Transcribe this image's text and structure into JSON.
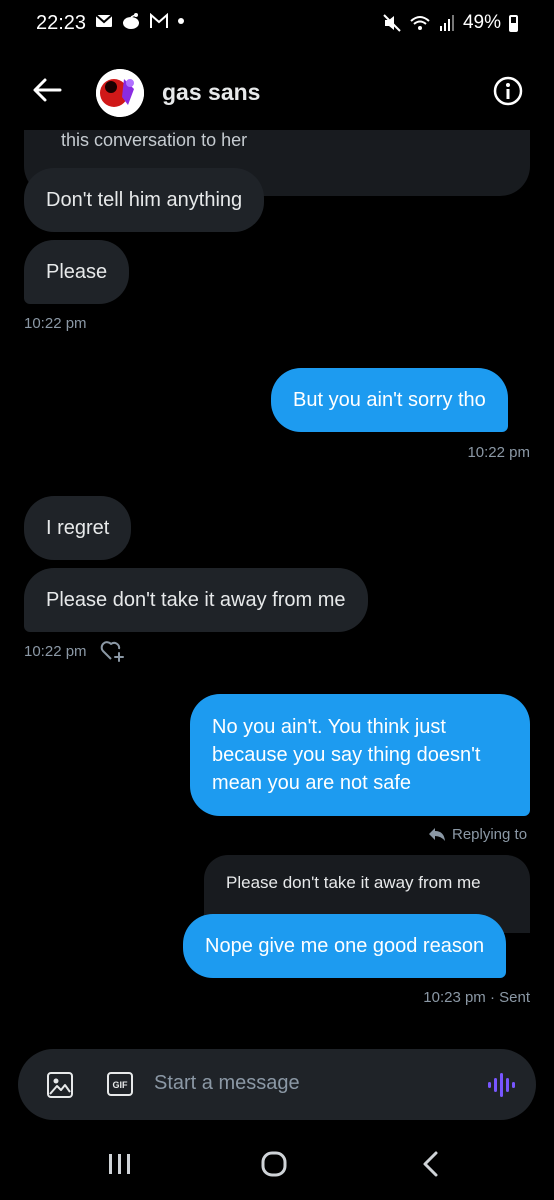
{
  "status_bar": {
    "time": "22:23",
    "notification_glyphs": "✉ ◓ M •",
    "battery": "49%"
  },
  "header": {
    "title": "gas sans"
  },
  "messages": {
    "quoted_partial": "this conversation to her",
    "in1": "Don't tell him anything",
    "in2": "Please",
    "time1": "10:22 pm",
    "out1": "But you ain't sorry tho",
    "time2": "10:22 pm",
    "in3": "I regret",
    "in4": "Please don't take it away from me",
    "time3": "10:22 pm",
    "out2_line1": "No you ain't. You think just",
    "out2_line2": "because you say thing doesn't",
    "out2_line3": "mean you are not safe",
    "replying_to": "Replying to",
    "reply_quote": "Please don't take it away from me",
    "out3": "Nope give me one good reason",
    "time4": "10:23 pm · Sent"
  },
  "composer": {
    "placeholder": "Start a message",
    "gif_label": "GIF"
  },
  "colors": {
    "accent": "#1d9bf0",
    "incoming_bubble": "#1f2328",
    "muted_text": "#8b98a5",
    "mic_purple": "#7856ff"
  }
}
